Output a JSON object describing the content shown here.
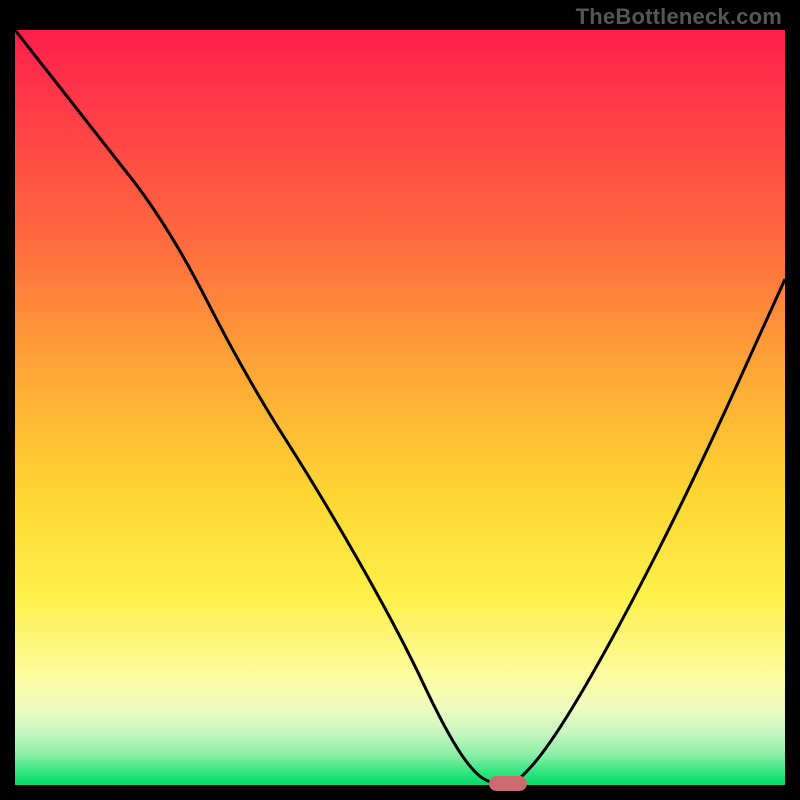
{
  "attribution": "TheBottleneck.com",
  "chart_data": {
    "type": "line",
    "title": "",
    "xlabel": "",
    "ylabel": "",
    "xlim": [
      0,
      100
    ],
    "ylim": [
      0,
      100
    ],
    "grid": false,
    "series": [
      {
        "name": "bottleneck-curve",
        "x": [
          0,
          10,
          20,
          30,
          40,
          50,
          56,
          60,
          63,
          65,
          70,
          78,
          88,
          100
        ],
        "values": [
          100,
          87,
          74,
          54,
          38,
          20,
          7,
          1,
          0,
          0,
          6,
          20,
          40,
          67
        ]
      }
    ],
    "annotations": [
      {
        "name": "optimal-marker",
        "x": 64,
        "y": 0
      }
    ],
    "background_gradient": [
      {
        "stop": 0.0,
        "color": "#ff1e4b"
      },
      {
        "stop": 0.28,
        "color": "#ff6a3e"
      },
      {
        "stop": 0.62,
        "color": "#ffd733"
      },
      {
        "stop": 0.86,
        "color": "#fdfca3"
      },
      {
        "stop": 0.96,
        "color": "#8ceea8"
      },
      {
        "stop": 1.0,
        "color": "#07d968"
      }
    ]
  },
  "colors": {
    "curve": "#000000",
    "marker": "#cd6a6e",
    "frame": "#000000",
    "attribution_text": "#565656"
  }
}
